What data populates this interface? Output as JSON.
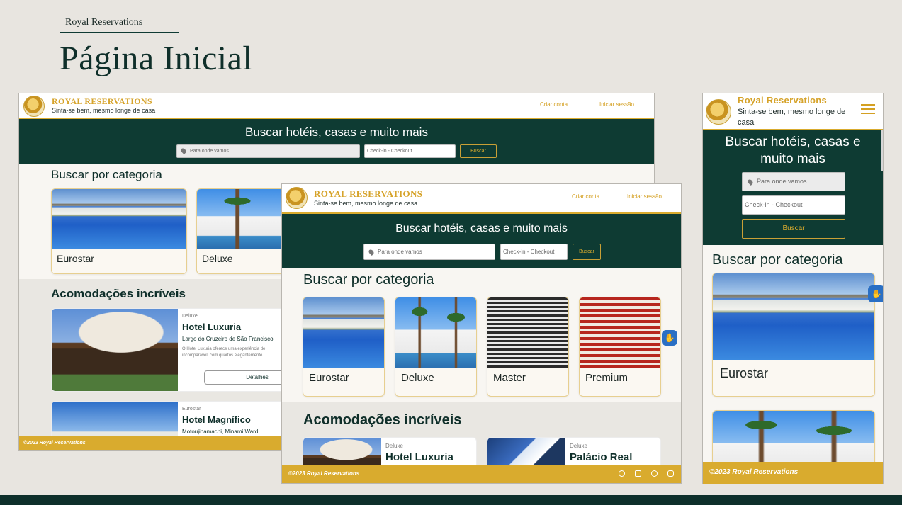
{
  "deck": {
    "subtitle": "Royal Reservations",
    "title": "Página Inicial"
  },
  "site": {
    "brand_caps": "ROYAL RESERVATIONS",
    "brand": "Royal Reservations",
    "tagline": "Sinta-se bem, mesmo longe de casa",
    "nav": {
      "signup": "Criar conta",
      "login": "Iniciar sessão"
    },
    "hero_title": "Buscar hotéis, casas e muito mais",
    "search": {
      "destination": "Para onde vamos",
      "dates": "Check-in - Checkout",
      "button": "Buscar"
    },
    "categories_title": "Buscar por categoria",
    "categories": [
      "Eurostar",
      "Deluxe",
      "Master",
      "Premium"
    ],
    "featured_title": "Acomodações incríveis",
    "hotels": [
      {
        "category": "Deluxe",
        "name": "Hotel Luxuria",
        "address": "Largo do Cruzeiro de São Francisco",
        "description_l1": "O Hotel Luxuria oferece uma experiência de",
        "description_l2": "incomparável, com quartos elegantemente",
        "button": "Detalhes"
      },
      {
        "category": "Eurostar",
        "name": "Hotel Magnífico",
        "address": "Motoujinamachi, Minami Ward,"
      },
      {
        "category": "Deluxe",
        "name": "Palácio Real"
      }
    ],
    "footer": "©2023 Royal Reservations"
  },
  "colors": {
    "dark_green": "#0e3b33",
    "gold": "#d9ab2e",
    "background": "#e8e5e0"
  }
}
